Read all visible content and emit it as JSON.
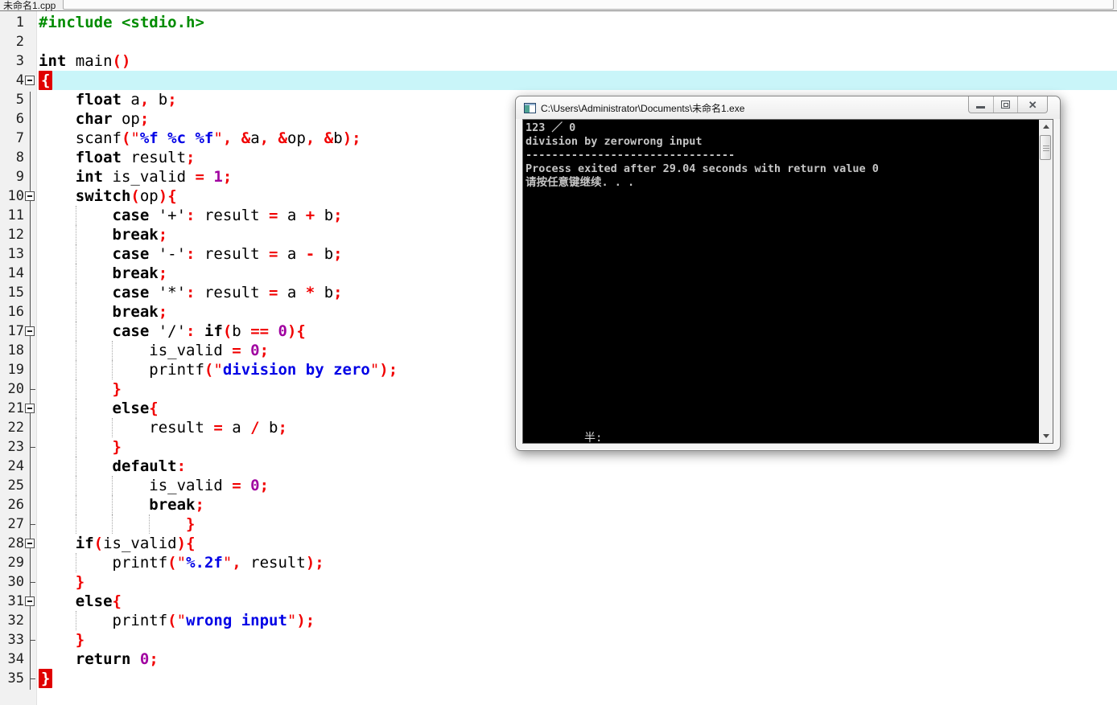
{
  "tab_bar": {
    "active_tab": "未命名1.cpp"
  },
  "colors": {
    "current_line_bg": "#c9f5f9",
    "brace_match_bg": "#e00000",
    "keyword": "#000000",
    "operator": "#f00000",
    "number": "#a000a0",
    "string_content": "#0000e6",
    "string_quote": "#f00000",
    "preprocessor": "#008c00",
    "console_text": "#c5c5c5"
  },
  "editor": {
    "current_line": 4,
    "lines": [
      {
        "n": 1,
        "fold": "none",
        "segs": [
          [
            "d",
            "#include <stdio.h>"
          ]
        ]
      },
      {
        "n": 2,
        "fold": "none",
        "segs": []
      },
      {
        "n": 3,
        "fold": "none",
        "segs": [
          [
            "k",
            "int"
          ],
          [
            "p",
            " main"
          ],
          [
            "o",
            "()"
          ]
        ]
      },
      {
        "n": 4,
        "fold": "box",
        "hl": true,
        "segs": [
          [
            "b",
            "{"
          ]
        ]
      },
      {
        "n": 5,
        "fold": "pass",
        "segs": [
          [
            "p",
            "    "
          ],
          [
            "k",
            "float"
          ],
          [
            "p",
            " a"
          ],
          [
            "o",
            ","
          ],
          [
            "p",
            " b"
          ],
          [
            "o",
            ";"
          ]
        ]
      },
      {
        "n": 6,
        "fold": "pass",
        "segs": [
          [
            "p",
            "    "
          ],
          [
            "k",
            "char"
          ],
          [
            "p",
            " op"
          ],
          [
            "o",
            ";"
          ]
        ]
      },
      {
        "n": 7,
        "fold": "pass",
        "segs": [
          [
            "p",
            "    scanf"
          ],
          [
            "o",
            "("
          ],
          [
            "q",
            "\""
          ],
          [
            "s",
            "%f %c %f"
          ],
          [
            "q",
            "\""
          ],
          [
            "o",
            ","
          ],
          [
            "p",
            " "
          ],
          [
            "o",
            "&"
          ],
          [
            "p",
            "a"
          ],
          [
            "o",
            ","
          ],
          [
            "p",
            " "
          ],
          [
            "o",
            "&"
          ],
          [
            "p",
            "op"
          ],
          [
            "o",
            ","
          ],
          [
            "p",
            " "
          ],
          [
            "o",
            "&"
          ],
          [
            "p",
            "b"
          ],
          [
            "o",
            ");"
          ]
        ]
      },
      {
        "n": 8,
        "fold": "pass",
        "segs": [
          [
            "p",
            "    "
          ],
          [
            "k",
            "float"
          ],
          [
            "p",
            " result"
          ],
          [
            "o",
            ";"
          ]
        ]
      },
      {
        "n": 9,
        "fold": "pass",
        "segs": [
          [
            "p",
            "    "
          ],
          [
            "k",
            "int"
          ],
          [
            "p",
            " is_valid "
          ],
          [
            "o",
            "="
          ],
          [
            "p",
            " "
          ],
          [
            "n",
            "1"
          ],
          [
            "o",
            ";"
          ]
        ]
      },
      {
        "n": 10,
        "fold": "box",
        "segs": [
          [
            "p",
            "    "
          ],
          [
            "k",
            "switch"
          ],
          [
            "o",
            "("
          ],
          [
            "p",
            "op"
          ],
          [
            "o",
            "){"
          ]
        ]
      },
      {
        "n": 11,
        "fold": "pass",
        "guides": [
          1
        ],
        "segs": [
          [
            "p",
            "        "
          ],
          [
            "k",
            "case"
          ],
          [
            "p",
            " '+'"
          ],
          [
            "o",
            ":"
          ],
          [
            "p",
            " result "
          ],
          [
            "o",
            "="
          ],
          [
            "p",
            " a "
          ],
          [
            "o",
            "+"
          ],
          [
            "p",
            " b"
          ],
          [
            "o",
            ";"
          ]
        ]
      },
      {
        "n": 12,
        "fold": "pass",
        "guides": [
          1
        ],
        "segs": [
          [
            "p",
            "        "
          ],
          [
            "k",
            "break"
          ],
          [
            "o",
            ";"
          ]
        ]
      },
      {
        "n": 13,
        "fold": "pass",
        "guides": [
          1
        ],
        "segs": [
          [
            "p",
            "        "
          ],
          [
            "k",
            "case"
          ],
          [
            "p",
            " '-'"
          ],
          [
            "o",
            ":"
          ],
          [
            "p",
            " result "
          ],
          [
            "o",
            "="
          ],
          [
            "p",
            " a "
          ],
          [
            "o",
            "-"
          ],
          [
            "p",
            " b"
          ],
          [
            "o",
            ";"
          ]
        ]
      },
      {
        "n": 14,
        "fold": "pass",
        "guides": [
          1
        ],
        "segs": [
          [
            "p",
            "        "
          ],
          [
            "k",
            "break"
          ],
          [
            "o",
            ";"
          ]
        ]
      },
      {
        "n": 15,
        "fold": "pass",
        "guides": [
          1
        ],
        "segs": [
          [
            "p",
            "        "
          ],
          [
            "k",
            "case"
          ],
          [
            "p",
            " '*'"
          ],
          [
            "o",
            ":"
          ],
          [
            "p",
            " result "
          ],
          [
            "o",
            "="
          ],
          [
            "p",
            " a "
          ],
          [
            "o",
            "*"
          ],
          [
            "p",
            " b"
          ],
          [
            "o",
            ";"
          ]
        ]
      },
      {
        "n": 16,
        "fold": "pass",
        "guides": [
          1
        ],
        "segs": [
          [
            "p",
            "        "
          ],
          [
            "k",
            "break"
          ],
          [
            "o",
            ";"
          ]
        ]
      },
      {
        "n": 17,
        "fold": "box",
        "guides": [
          1
        ],
        "segs": [
          [
            "p",
            "        "
          ],
          [
            "k",
            "case"
          ],
          [
            "p",
            " '/'"
          ],
          [
            "o",
            ":"
          ],
          [
            "p",
            " "
          ],
          [
            "k",
            "if"
          ],
          [
            "o",
            "("
          ],
          [
            "p",
            "b "
          ],
          [
            "o",
            "=="
          ],
          [
            "p",
            " "
          ],
          [
            "n",
            "0"
          ],
          [
            "o",
            "){"
          ]
        ]
      },
      {
        "n": 18,
        "fold": "pass",
        "guides": [
          1,
          2
        ],
        "segs": [
          [
            "p",
            "            is_valid "
          ],
          [
            "o",
            "="
          ],
          [
            "p",
            " "
          ],
          [
            "n",
            "0"
          ],
          [
            "o",
            ";"
          ]
        ]
      },
      {
        "n": 19,
        "fold": "pass",
        "guides": [
          1,
          2
        ],
        "segs": [
          [
            "p",
            "            printf"
          ],
          [
            "o",
            "("
          ],
          [
            "q",
            "\""
          ],
          [
            "s",
            "division by zero"
          ],
          [
            "q",
            "\""
          ],
          [
            "o",
            ");"
          ]
        ]
      },
      {
        "n": 20,
        "fold": "tick",
        "guides": [
          1
        ],
        "segs": [
          [
            "p",
            "        "
          ],
          [
            "o",
            "}"
          ]
        ]
      },
      {
        "n": 21,
        "fold": "box",
        "guides": [
          1
        ],
        "segs": [
          [
            "p",
            "        "
          ],
          [
            "k",
            "else"
          ],
          [
            "o",
            "{"
          ]
        ]
      },
      {
        "n": 22,
        "fold": "pass",
        "guides": [
          1,
          2
        ],
        "segs": [
          [
            "p",
            "            result "
          ],
          [
            "o",
            "="
          ],
          [
            "p",
            " a "
          ],
          [
            "o",
            "/"
          ],
          [
            "p",
            " b"
          ],
          [
            "o",
            ";"
          ]
        ]
      },
      {
        "n": 23,
        "fold": "tick",
        "guides": [
          1
        ],
        "segs": [
          [
            "p",
            "        "
          ],
          [
            "o",
            "}"
          ]
        ]
      },
      {
        "n": 24,
        "fold": "pass",
        "guides": [
          1
        ],
        "segs": [
          [
            "p",
            "        "
          ],
          [
            "k",
            "default"
          ],
          [
            "o",
            ":"
          ]
        ]
      },
      {
        "n": 25,
        "fold": "pass",
        "guides": [
          1,
          2
        ],
        "segs": [
          [
            "p",
            "            is_valid "
          ],
          [
            "o",
            "="
          ],
          [
            "p",
            " "
          ],
          [
            "n",
            "0"
          ],
          [
            "o",
            ";"
          ]
        ]
      },
      {
        "n": 26,
        "fold": "pass",
        "guides": [
          1,
          2
        ],
        "segs": [
          [
            "p",
            "            "
          ],
          [
            "k",
            "break"
          ],
          [
            "o",
            ";"
          ]
        ]
      },
      {
        "n": 27,
        "fold": "tick",
        "guides": [
          1,
          2,
          3
        ],
        "segs": [
          [
            "p",
            "                "
          ],
          [
            "o",
            "}"
          ]
        ]
      },
      {
        "n": 28,
        "fold": "box",
        "segs": [
          [
            "p",
            "    "
          ],
          [
            "k",
            "if"
          ],
          [
            "o",
            "("
          ],
          [
            "p",
            "is_valid"
          ],
          [
            "o",
            "){"
          ]
        ]
      },
      {
        "n": 29,
        "fold": "pass",
        "guides": [
          1
        ],
        "segs": [
          [
            "p",
            "        printf"
          ],
          [
            "o",
            "("
          ],
          [
            "q",
            "\""
          ],
          [
            "s",
            "%.2f"
          ],
          [
            "q",
            "\""
          ],
          [
            "o",
            ","
          ],
          [
            "p",
            " result"
          ],
          [
            "o",
            ");"
          ]
        ]
      },
      {
        "n": 30,
        "fold": "tick",
        "segs": [
          [
            "p",
            "    "
          ],
          [
            "o",
            "}"
          ]
        ]
      },
      {
        "n": 31,
        "fold": "box",
        "segs": [
          [
            "p",
            "    "
          ],
          [
            "k",
            "else"
          ],
          [
            "o",
            "{"
          ]
        ]
      },
      {
        "n": 32,
        "fold": "pass",
        "guides": [
          1
        ],
        "segs": [
          [
            "p",
            "        printf"
          ],
          [
            "o",
            "("
          ],
          [
            "q",
            "\""
          ],
          [
            "s",
            "wrong input"
          ],
          [
            "q",
            "\""
          ],
          [
            "o",
            ");"
          ]
        ]
      },
      {
        "n": 33,
        "fold": "tick",
        "segs": [
          [
            "p",
            "    "
          ],
          [
            "o",
            "}"
          ]
        ]
      },
      {
        "n": 34,
        "fold": "pass",
        "segs": [
          [
            "p",
            "    "
          ],
          [
            "k",
            "return"
          ],
          [
            "p",
            " "
          ],
          [
            "n",
            "0"
          ],
          [
            "o",
            ";"
          ]
        ]
      },
      {
        "n": 35,
        "fold": "corner",
        "segs": [
          [
            "b",
            "}"
          ]
        ]
      }
    ]
  },
  "console": {
    "title": "C:\\Users\\Administrator\\Documents\\未命名1.exe",
    "buttons": {
      "minimize": "minimize",
      "maximize": "maximize",
      "close": "close"
    },
    "output_lines": [
      "123 ／ 0",
      "division by zerowrong input",
      "--------------------------------",
      "Process exited after 29.04 seconds with return value 0",
      "请按任意键继续. . ."
    ],
    "ime_indicator": "半:"
  }
}
